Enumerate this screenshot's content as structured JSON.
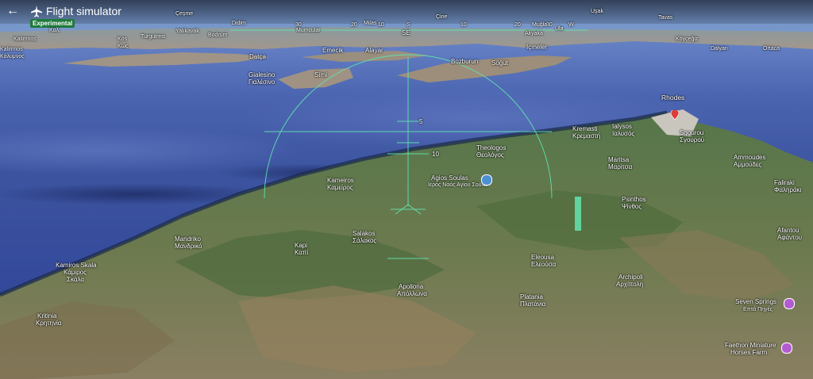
{
  "header": {
    "back_label": "←",
    "title": "Flight simulator",
    "badge": "Experimental"
  },
  "hud": {
    "ticks_top": [
      "30",
      "20",
      "10",
      "S",
      "10",
      "20",
      "30",
      "W"
    ],
    "pitch": [
      "5",
      "10"
    ],
    "heading": "SE"
  },
  "places": {
    "cesme": "Çeşme",
    "usak": "Uşak",
    "cine": "Çine",
    "tavas": "Tavas",
    "kos_small": "Καλ.",
    "kalimnos": "Kalimnos",
    "kalimnos_gr": "Κάλυμνος",
    "kos": "Kos",
    "kos_gr": "Κως",
    "turgutreis": "Turgutreis",
    "yalikavak": "Yalıkavak",
    "bodrum": "Bodrum",
    "didim": "Didim",
    "milas": "Milas",
    "mumcular": "Mumcular",
    "mugla": "Muğla",
    "akyaka": "Akyaka",
    "ula": "Ula",
    "koycegiz": "Köyceğiz",
    "dalyan": "Dalyan",
    "ortaca": "Ortaca",
    "datca": "Datça",
    "emecik": "Emecik",
    "alayar": "Alayar",
    "icmeler": "İçmeler",
    "bozburun": "Bozburun",
    "sogut": "Söğüt",
    "gialesino": "Gialesino",
    "gialesino_gr": "Γιαλέσινο",
    "simi": "Sími",
    "rhodes": "Rhodes",
    "kremasti": "Kremasti",
    "kremasti_gr": "Κρεμαστή",
    "ialysos": "Ialysos",
    "ialysos_gr": "Ιαλυσός",
    "sgourou": "Sgourou",
    "sgourou_gr": "Σγουρού",
    "theologos": "Theologos",
    "theologos_gr": "Θεολόγος",
    "agios_soulas": "Agios Soulas",
    "agios_soulas_gr": "Ιερός Ναός Αγίου Σούλα",
    "maritsa": "Maritsa",
    "maritsa_gr": "Μαρίτσα",
    "ammoudes": "Ammoudes",
    "ammoudes_gr": "Αμμούδες",
    "kameiros": "Kameiros",
    "kameiros_gr": "Καμείρος",
    "faliraki": "Faliraki",
    "faliraki_gr": "Φαληράκι",
    "psinthos": "Psinthos",
    "psinthos_gr": "Ψίνθος",
    "afantou": "Afantou",
    "afantou_gr": "Αφάντου",
    "mandriko": "Mandriko",
    "mandriko_gr": "Μανδρικό",
    "salakos": "Salakos",
    "salakos_gr": "Σάλακος",
    "kapi": "Kapi",
    "kapi_gr": "Καπί",
    "kamiros_skala": "Kamiros Skala",
    "kamiros_skala_gr1": "Κάμιρος",
    "kamiros_skala_gr2": "Σκάλα",
    "eleousa": "Eleousa",
    "eleousa_gr": "Ελεούσα",
    "archipoli": "Archipoli",
    "archipoli_gr": "Αρχίπολη",
    "apollona": "Apollona",
    "apollona_gr": "Απόλλωνα",
    "platania": "Platania",
    "platania_gr": "Πλατάνια",
    "kritinia": "Kritinia",
    "kritinia_gr": "Κρητηνία",
    "seven_springs": "Seven Springs",
    "seven_springs_gr": "Επτά Πηγές",
    "faethon": "Faethon Miniature",
    "faethon2": "Horses Farm"
  },
  "colors": {
    "hud": "#5fe5b0",
    "badge": "#1e7a3c",
    "poi": "#b35bd3",
    "pin": "#e53935"
  }
}
